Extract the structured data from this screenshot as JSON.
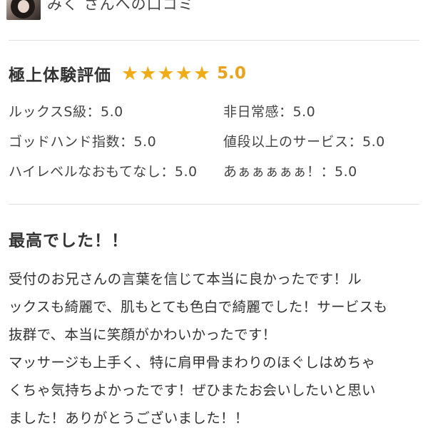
{
  "header": {
    "title": "みく さんへの口コミ"
  },
  "rating": {
    "title": "極上体験評価",
    "stars_count": 5,
    "star_color": "#f0ac16",
    "score": "5.0",
    "items": [
      {
        "label": "ルックスS級",
        "value": "5.0"
      },
      {
        "label": "非日常感",
        "value": "5.0"
      },
      {
        "label": "ゴッドハンド指数",
        "value": "5.0"
      },
      {
        "label": "値段以上のサービス",
        "value": "5.0"
      },
      {
        "label": "ハイレベルなおもてなし",
        "value": "5.0"
      },
      {
        "label": "あぁぁぁぁぁ！",
        "value": "5.0"
      }
    ],
    "separator": "："
  },
  "review": {
    "title": "最高でした！！",
    "lines": [
      "受付のお兄さんの言葉を信じて本当に良かったです！ル",
      "ックスも綺麗で、肌もとても色白で綺麗でした！サービスも",
      "抜群で、本当に笑顔がかわいかったです！",
      "マッサージも上手く、特に肩甲骨まわりのほぐしはめちゃ",
      "くちゃ気持ちよかったです！ぜひまたお会いしたいと思い",
      "ました！ありがとうございました！！"
    ]
  }
}
